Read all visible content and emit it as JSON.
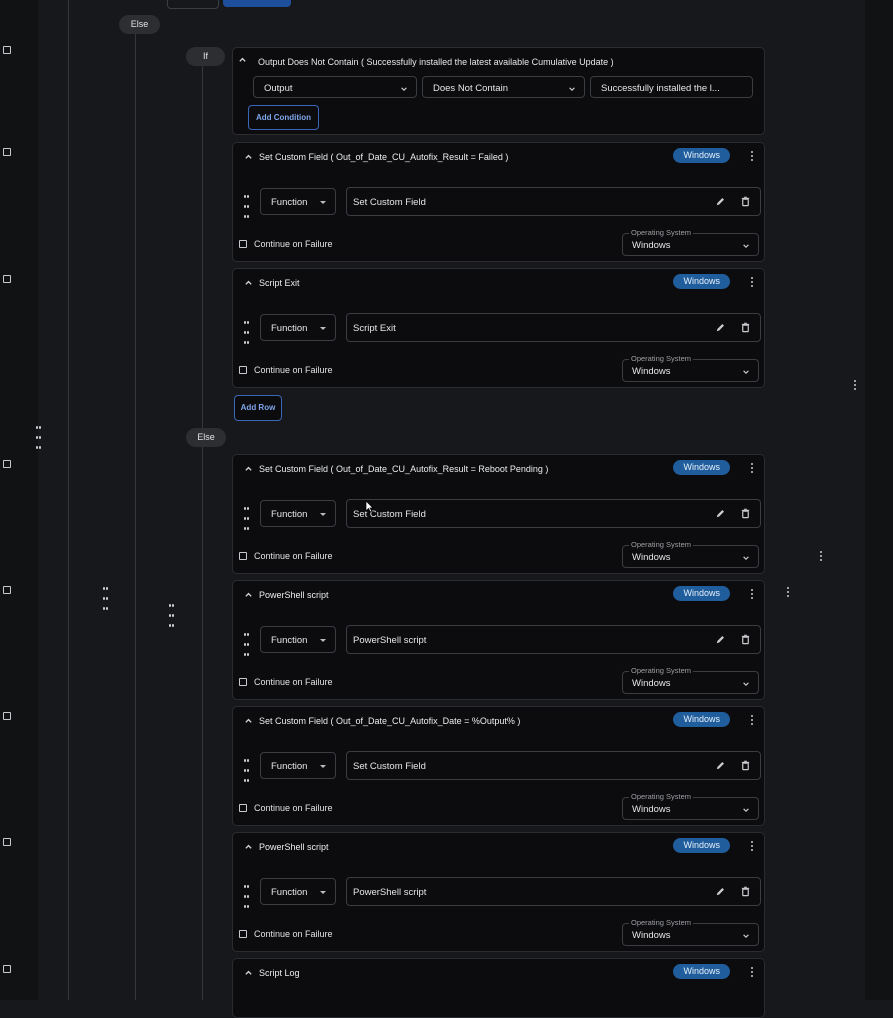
{
  "else_top_label": "Else",
  "if_label": "If",
  "else_mid_label": "Else",
  "condition": {
    "title": "Output Does Not Contain ( Successfully installed the latest available Cumulative Update )",
    "field_value": "Output",
    "operator_value": "Does Not Contain",
    "match_value": "Successfully installed the l...",
    "add_condition_label": "Add Condition"
  },
  "add_row_label": "Add Row",
  "common": {
    "badge": "Windows",
    "function_label": "Function",
    "continue_on_failure": "Continue on Failure",
    "os_legend": "Operating System",
    "os_value": "Windows"
  },
  "cards": [
    {
      "title": "Set Custom Field ( Out_of_Date_CU_Autofix_Result = Failed )",
      "value": "Set Custom Field"
    },
    {
      "title": "Script Exit",
      "value": "Script Exit"
    },
    {
      "title": "Set Custom Field ( Out_of_Date_CU_Autofix_Result = Reboot Pending )",
      "value": "Set Custom Field"
    },
    {
      "title": "PowerShell script",
      "value": "PowerShell script"
    },
    {
      "title": "Set Custom Field ( Out_of_Date_CU_Autofix_Date = %Output% )",
      "value": "Set Custom Field"
    },
    {
      "title": "PowerShell script",
      "value": "PowerShell script"
    },
    {
      "title": "Script Log"
    }
  ]
}
